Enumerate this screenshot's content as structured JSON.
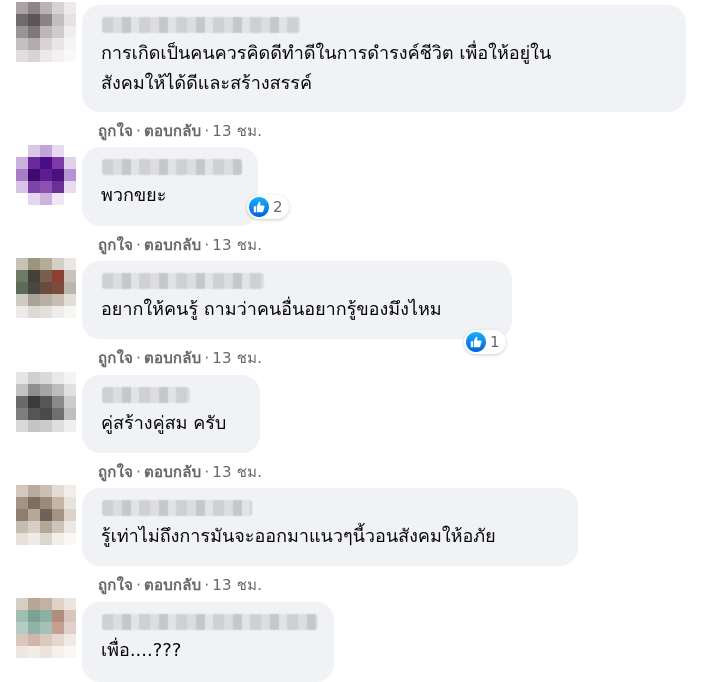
{
  "actions": {
    "like_label": "ถูกใจ",
    "reply_label": "ตอบกลับ",
    "separator": "·"
  },
  "comments": [
    {
      "text": "การเกิดเป็นคนควรคิดดีทำดีในการดำรงค์ชีวิต เพื่อให้อยู่ใน\nสังคมให้ได้ดีและสร้างสรรค์",
      "time": "13 ชม.",
      "avatar_colors": [
        "#a9a3a5",
        "#8c8486",
        "#b9b3b4",
        "#d6d1d2",
        "#eeeaea",
        "#6f6a6c",
        "#5b5557",
        "#8a8385",
        "#c2bdbe",
        "#e6e2e3",
        "#9a9496",
        "#7e7879",
        "#bcb6b7",
        "#cfcacb",
        "#f1eeee",
        "#c4bfc0",
        "#b2acad",
        "#d8d4d5",
        "#e9e6e6",
        "#f6f4f4",
        "#e2dedf",
        "#d8d4d4",
        "#ece9e9",
        "#f3f1f1",
        "#faf9f9"
      ]
    },
    {
      "text": "พวกขยะ",
      "time": "13 ชม.",
      "reaction_icon": "like-icon",
      "reaction_count": "2",
      "avatar_colors": [
        "#ffffff",
        "#d9c8e6",
        "#c3a4da",
        "#e7dcef",
        "#ffffff",
        "#c9b0de",
        "#6a2a9c",
        "#4b0d85",
        "#7b3aa8",
        "#e1d2ec",
        "#a77ec6",
        "#3f0a70",
        "#5e1c93",
        "#4a1080",
        "#b893d3",
        "#d7c4e6",
        "#7c44a7",
        "#8b52b2",
        "#6b2f98",
        "#e8dcf0",
        "#ffffff",
        "#e3d6ee",
        "#cbb2df",
        "#efe7f5",
        "#ffffff"
      ]
    },
    {
      "text": "อยากให้คนรู้ ถามว่าคนอื่นอยากรู้ของมึงไหม",
      "time": "13 ชม.",
      "reaction_icon": "like-icon",
      "reaction_count": "1",
      "avatar_colors": [
        "#c7c2b6",
        "#9b957f",
        "#b3ac98",
        "#d3cfc6",
        "#e9e7e2",
        "#6d7b64",
        "#45403a",
        "#7a5e4f",
        "#8c3f33",
        "#c9c3bb",
        "#5c6b57",
        "#4a4640",
        "#6d4a3d",
        "#7f4a3e",
        "#bdb6ac",
        "#cfcac2",
        "#a9a398",
        "#b9b0a5",
        "#c7bdb3",
        "#e2ded8",
        "#ecebe8",
        "#dddad5",
        "#e4e1dc",
        "#efedea",
        "#f7f6f4"
      ]
    },
    {
      "text": "คู่สร้างคู่สม ครับ",
      "time": "13 ชม.",
      "avatar_colors": [
        "#e5e5e5",
        "#cfcfcf",
        "#dadada",
        "#e9e9e9",
        "#f4f4f4",
        "#c2c2c2",
        "#8e8e8e",
        "#a6a6a6",
        "#bdbdbd",
        "#e0e0e0",
        "#6a6a6a",
        "#3b3b3b",
        "#575757",
        "#8a8a8a",
        "#cccccc",
        "#7e7e7e",
        "#555555",
        "#4b4b4b",
        "#6f6f6f",
        "#bfbfbf",
        "#d9d9d9",
        "#c4c4c4",
        "#cbcbcb",
        "#dfdfdf",
        "#efefef"
      ]
    },
    {
      "text": "รู้เท่าไม่ถึงการมันจะออกมาแนวๆนี้วอนสังคมให้อภัย",
      "time": "13 ชม.",
      "avatar_colors": [
        "#d2c8bf",
        "#b8ab9d",
        "#c9bfb4",
        "#e2dcd5",
        "#f1eeea",
        "#a29484",
        "#7e6e5e",
        "#9b8a78",
        "#c3b6a8",
        "#e8e3dd",
        "#8d7f70",
        "#b7a796",
        "#6f6356",
        "#a39383",
        "#dcd4cb",
        "#c5bcb2",
        "#d7cfc5",
        "#b3a797",
        "#cdc4ba",
        "#ece8e3",
        "#e6e1db",
        "#efebe6",
        "#ddd6ce",
        "#f2efeb",
        "#faf8f6"
      ]
    },
    {
      "text": "เพื่อ....???",
      "time": "",
      "avatar_colors": [
        "#d6cdc4",
        "#b9a595",
        "#c3b2a3",
        "#ddd3ca",
        "#ece6e1",
        "#9fbdb2",
        "#79a294",
        "#8db0a4",
        "#b48c7c",
        "#d8c6bb",
        "#b6cbc3",
        "#8fb3a6",
        "#a7c1b7",
        "#c69f91",
        "#e0d2ca",
        "#d9c7bd",
        "#cfb6a8",
        "#d8c9bf",
        "#e3d7cf",
        "#f0e9e4",
        "#eee6e0",
        "#f2ece7",
        "#ebe3dc",
        "#f5f0ec",
        "#faf7f5"
      ]
    }
  ]
}
